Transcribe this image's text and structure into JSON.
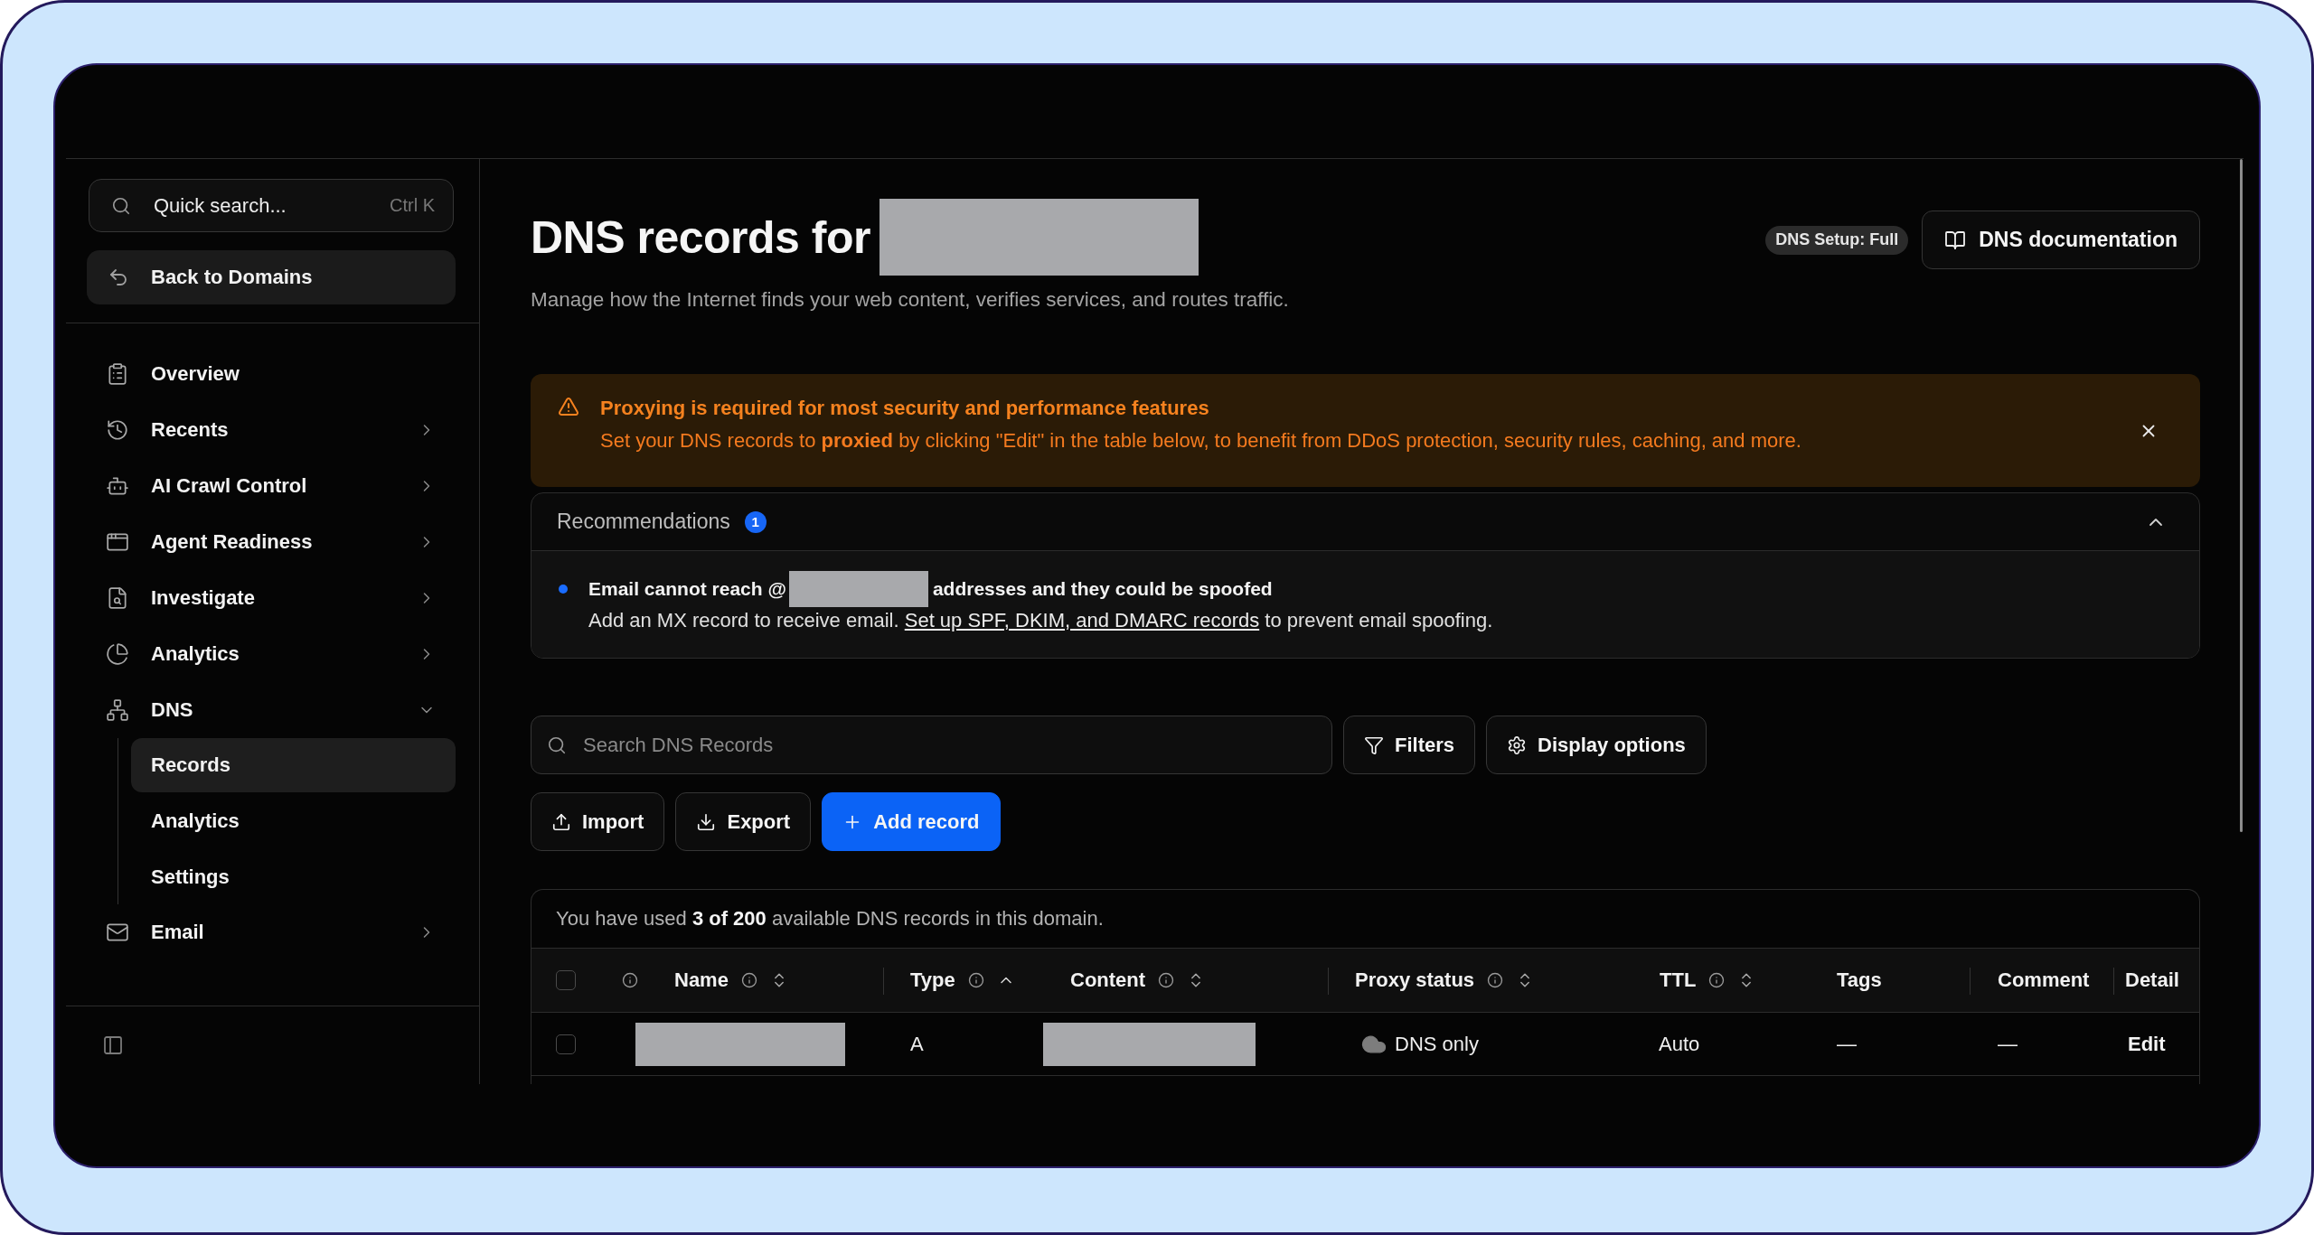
{
  "sidebar": {
    "search": {
      "placeholder": "Quick search...",
      "shortcut": "Ctrl K"
    },
    "back_link": "Back to Domains",
    "items": [
      {
        "label": "Overview",
        "kind": "link",
        "selected": false
      },
      {
        "label": "Recents",
        "kind": "group",
        "selected": false,
        "expanded": false
      },
      {
        "label": "AI Crawl Control",
        "kind": "group",
        "selected": false,
        "expanded": false
      },
      {
        "label": "Agent Readiness",
        "kind": "group",
        "selected": false,
        "expanded": false
      },
      {
        "label": "Investigate",
        "kind": "group",
        "selected": false,
        "expanded": false
      },
      {
        "label": "Analytics",
        "kind": "group",
        "selected": false,
        "expanded": false
      },
      {
        "label": "DNS",
        "kind": "group",
        "selected": false,
        "expanded": true,
        "children": [
          {
            "label": "Records",
            "selected": true
          },
          {
            "label": "Analytics",
            "selected": false
          },
          {
            "label": "Settings",
            "selected": false
          }
        ]
      },
      {
        "label": "Email",
        "kind": "group",
        "selected": false,
        "expanded": false
      }
    ]
  },
  "page": {
    "title": "DNS records for",
    "subtitle": "Manage how the Internet finds your web content, verifies services, and routes traffic.",
    "setup_badge": "DNS Setup: Full",
    "docs_button": "DNS documentation"
  },
  "alert": {
    "title": "Proxying is required for most security and performance features",
    "message": "Set your DNS records to **proxied** by clicking \"Edit\" in the table below, to benefit from DDoS protection, security rules, caching, and more."
  },
  "recommendations": {
    "title": "Recommendations",
    "count": "1",
    "expanded": true,
    "items": [
      {
        "title_before": "Email cannot reach @",
        "title_after": "addresses and they could be spoofed",
        "text_before": "Add an MX record to receive email.",
        "link": "Set up SPF, DKIM, and DMARC records",
        "text_after": "to prevent email spoofing."
      }
    ]
  },
  "toolbar": {
    "search": {
      "placeholder": "Search DNS Records"
    },
    "filters": "Filters",
    "display_options": "Display options",
    "actions": [
      {
        "label": "Import",
        "kind": "secondary"
      },
      {
        "label": "Export",
        "kind": "secondary"
      },
      {
        "label": "Add record",
        "kind": "primary"
      }
    ]
  },
  "table": {
    "usage": "You have used **3 of 200** available DNS records in this domain.",
    "all_selected": false,
    "columns": [
      {
        "label": "Name",
        "info": true,
        "sortable": true,
        "sorted": false
      },
      {
        "label": "Type",
        "info": true,
        "sortable": true,
        "sorted": true
      },
      {
        "label": "Content",
        "info": true,
        "sortable": true,
        "sorted": false
      },
      {
        "label": "Proxy status",
        "info": true,
        "sortable": true,
        "sorted": false
      },
      {
        "label": "TTL",
        "info": true,
        "sortable": true,
        "sorted": false
      },
      {
        "label": "Tags",
        "info": false,
        "sortable": false
      },
      {
        "label": "Comment",
        "info": false,
        "sortable": false
      },
      {
        "label": "Detail",
        "info": false,
        "sortable": false
      }
    ],
    "rows": [
      {
        "selected": false,
        "type": "A",
        "proxied": false,
        "proxy_status": "DNS only",
        "ttl": "Auto",
        "tags": "—",
        "comment": "—",
        "action": "Edit"
      }
    ]
  }
}
